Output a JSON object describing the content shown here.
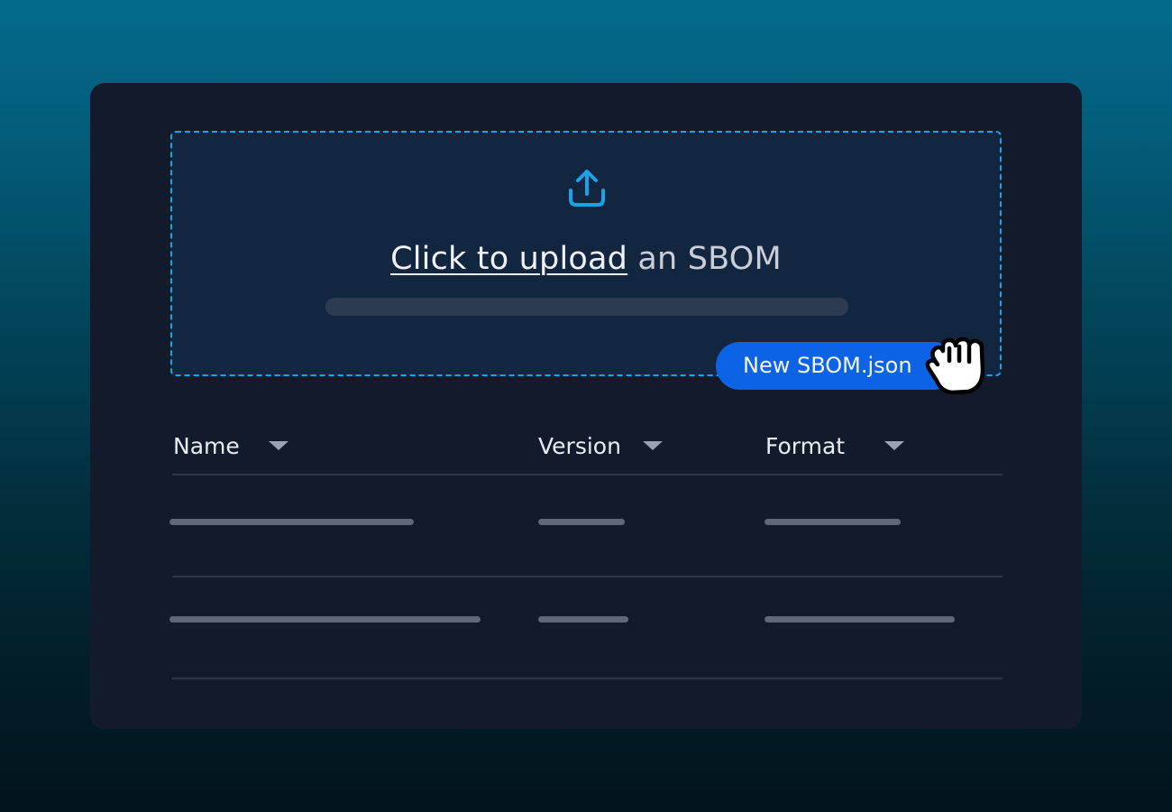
{
  "upload": {
    "link_text": "Click to upload",
    "rest_text": " an SBOM",
    "icon": "upload-icon",
    "progress": 0
  },
  "drag_file": {
    "label": "New SBOM.json",
    "cursor_icon": "grab-hand-icon"
  },
  "table": {
    "columns": [
      {
        "label": "Name",
        "sort_icon": "caret-down-icon"
      },
      {
        "label": "Version",
        "sort_icon": "caret-down-icon"
      },
      {
        "label": "Format",
        "sort_icon": "caret-down-icon"
      }
    ]
  },
  "colors": {
    "accent": "#1aa3e8",
    "pill": "#0d63e6",
    "panel": "#121a2b",
    "dropzone": "#132640"
  }
}
